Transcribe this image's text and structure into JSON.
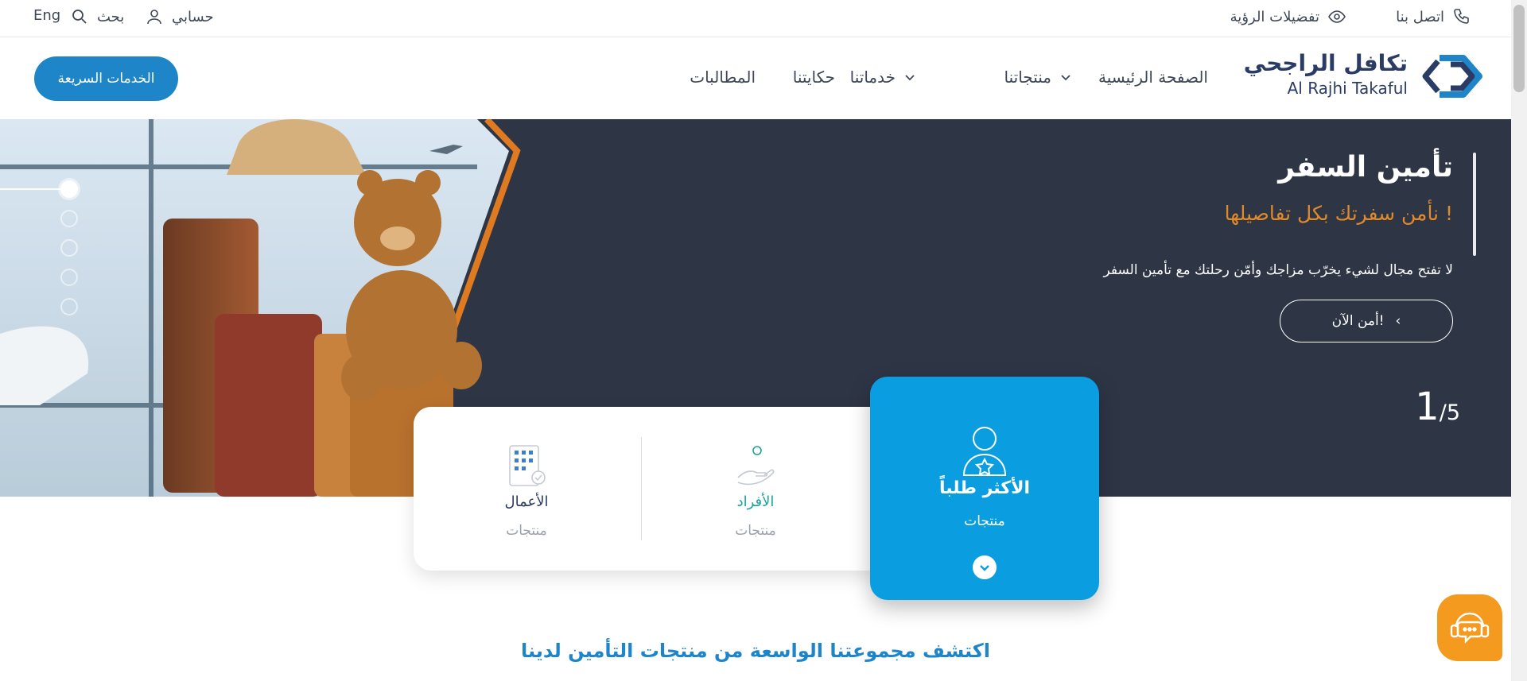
{
  "utility": {
    "contact": "اتصل بنا",
    "accessibility": "تفضيلات الرؤية",
    "account": "حسابي",
    "search": "بحث",
    "language": "Eng"
  },
  "brand": {
    "name_ar": "تكافل الراجحي",
    "name_en": "Al Rajhi Takaful"
  },
  "nav": {
    "items": [
      {
        "label": "الصفحة الرئيسية"
      },
      {
        "label": "منتجاتنا"
      },
      {
        "label": "خدماتنا"
      },
      {
        "label": "حكايتنا"
      },
      {
        "label": "المطالبات"
      }
    ],
    "quick_services": "الخدمات السريعة"
  },
  "hero": {
    "title": "تأمين السفر",
    "subtitle": "نأمن سفرتك بكل تفاصيلها !",
    "description": "لا تفتح مجال لشيء يخرّب مزاجك وأمّن رحلتك مع تأمين السفر",
    "cta": "أمن الآن!",
    "counter_current": "1",
    "counter_total": "/5",
    "active_slide": 1,
    "slides": 5
  },
  "products": {
    "featured_title": "الأكثر طلباً",
    "featured_sub": "منتجات",
    "individuals_title": "الأفراد",
    "individuals_sub": "منتجات",
    "business_title": "الأعمال",
    "business_sub": "منتجات"
  },
  "discover": "اكتشف مجموعتنا الواسعة من منتجات التأمين لدينا",
  "colors": {
    "primary": "#1e86c8",
    "featured": "#0a9ee0",
    "hero_bg": "#2e3545",
    "accent_orange": "#e08a2a",
    "teal": "#1aa39a",
    "chat": "#f39a1f"
  },
  "icons": {
    "contact": "phone-icon",
    "accessibility": "eye-icon",
    "account": "user-icon",
    "search": "search-icon",
    "featured": "user-star-icon",
    "individuals": "hand-person-icon",
    "business": "building-icon",
    "chat": "support-chat-icon"
  }
}
